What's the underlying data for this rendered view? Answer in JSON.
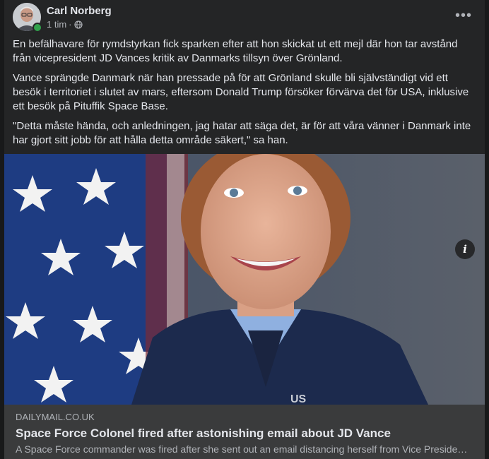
{
  "post": {
    "author": "Carl Norberg",
    "time": "1 tim",
    "separator": "·",
    "privacy_icon": "globe-icon",
    "more_icon": "more-options-icon",
    "more_label": "•••",
    "paragraphs": [
      "En befälhavare för rymdstyrkan fick sparken efter att hon skickat ut ett mejl där hon tar avstånd från vicepresident JD Vances kritik av Danmarks tillsyn över Grönland.",
      "Vance  sprängde Danmark när han pressade på för att Grönland skulle bli självständigt vid ett besök i territoriet i slutet av mars, eftersom Donald Trump  försöker förvärva det för USA, inklusive ett besök på Pituffik Space Base.",
      "\"Detta måste hända, och anledningen, jag hatar att säga det, är för att våra vänner i Danmark inte har gjort sitt jobb för att hålla detta område säkert,\" sa han."
    ]
  },
  "link": {
    "domain": "DAILYMAIL.CO.UK",
    "headline": "Space Force Colonel fired after astonishing email about JD Vance",
    "description": "A Space Force commander was fired after she sent out an email distancing herself from Vice President JD Vance's criticism of Denmark's oversight of Greenland.",
    "info_label": "i",
    "uniform_letters": "US"
  },
  "colors": {
    "background": "#18191a",
    "card": "#242526",
    "link_box": "#3a3b3c",
    "online": "#31a24c"
  }
}
